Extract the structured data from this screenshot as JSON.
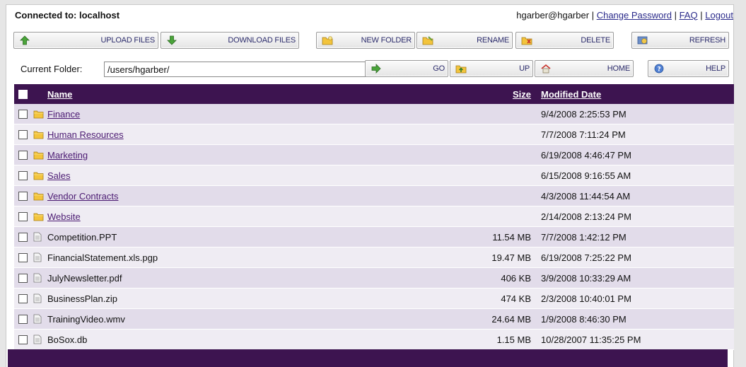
{
  "header": {
    "connected": "Connected to: localhost",
    "user": "hgarber@hgarber",
    "sep": "|",
    "change_password": "Change Password",
    "faq": "FAQ",
    "logout": "Logout"
  },
  "toolbar": {
    "upload": "UPLOAD FILES",
    "download": "DOWNLOAD FILES",
    "new_folder": "NEW FOLDER",
    "rename": "RENAME",
    "delete": "DELETE",
    "refresh": "REFRESH",
    "go": "GO",
    "up": "UP",
    "home": "HOME",
    "help": "HELP"
  },
  "folder": {
    "label": "Current Folder:",
    "value": "/users/hgarber/"
  },
  "table": {
    "headers": {
      "name": "Name",
      "size": "Size",
      "modified": "Modified Date"
    },
    "rows": [
      {
        "type": "folder",
        "name": "Finance",
        "size": "",
        "modified": "9/4/2008 2:25:53 PM"
      },
      {
        "type": "folder",
        "name": "Human Resources",
        "size": "",
        "modified": "7/7/2008 7:11:24 PM"
      },
      {
        "type": "folder",
        "name": "Marketing",
        "size": "",
        "modified": "6/19/2008 4:46:47 PM"
      },
      {
        "type": "folder",
        "name": "Sales",
        "size": "",
        "modified": "6/15/2008 9:16:55 AM"
      },
      {
        "type": "folder",
        "name": "Vendor Contracts",
        "size": "",
        "modified": "4/3/2008 11:44:54 AM"
      },
      {
        "type": "folder",
        "name": "Website",
        "size": "",
        "modified": "2/14/2008 2:13:24 PM"
      },
      {
        "type": "file",
        "name": "Competition.PPT",
        "size": "11.54 MB",
        "modified": "7/7/2008 1:42:12 PM"
      },
      {
        "type": "file",
        "name": "FinancialStatement.xls.pgp",
        "size": "19.47 MB",
        "modified": "6/19/2008 7:25:22 PM"
      },
      {
        "type": "file",
        "name": "JulyNewsletter.pdf",
        "size": "406 KB",
        "modified": "3/9/2008 10:33:29 AM"
      },
      {
        "type": "file",
        "name": "BusinessPlan.zip",
        "size": "474 KB",
        "modified": "2/3/2008 10:40:01 PM"
      },
      {
        "type": "file",
        "name": "TrainingVideo.wmv",
        "size": "24.64 MB",
        "modified": "1/9/2008 8:46:30 PM"
      },
      {
        "type": "file",
        "name": "BoSox.db",
        "size": "1.15 MB",
        "modified": "10/28/2007 11:35:25 PM"
      }
    ]
  },
  "colors": {
    "header_bg": "#3d1450",
    "row_alt": "#e2dcea",
    "row_norm": "#efecf3",
    "link": "#4b1a72"
  }
}
